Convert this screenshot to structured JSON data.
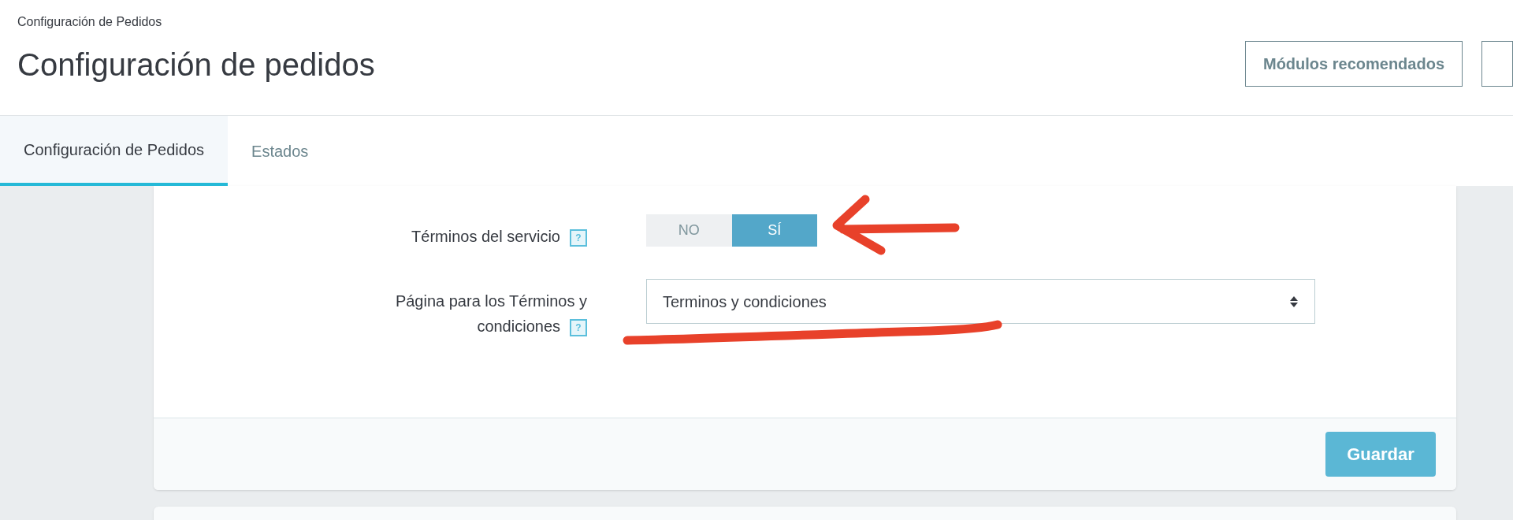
{
  "breadcrumb": "Configuración de Pedidos",
  "title": "Configuración de pedidos",
  "header_buttons": [
    "Módulos recomendados"
  ],
  "tabs": [
    {
      "label": "Configuración de Pedidos",
      "selected": true
    },
    {
      "label": "Estados",
      "selected": false
    }
  ],
  "form": {
    "rows": [
      {
        "kind": "switch",
        "label": "Términos del servicio",
        "help": "?",
        "options": [
          {
            "label": "NO",
            "selected": false
          },
          {
            "label": "SÍ",
            "selected": true
          }
        ]
      },
      {
        "kind": "select",
        "label": "Página para los Términos y condiciones",
        "help": "?",
        "value": "Terminos y condiciones"
      }
    ]
  },
  "save_button": "Guardar"
}
